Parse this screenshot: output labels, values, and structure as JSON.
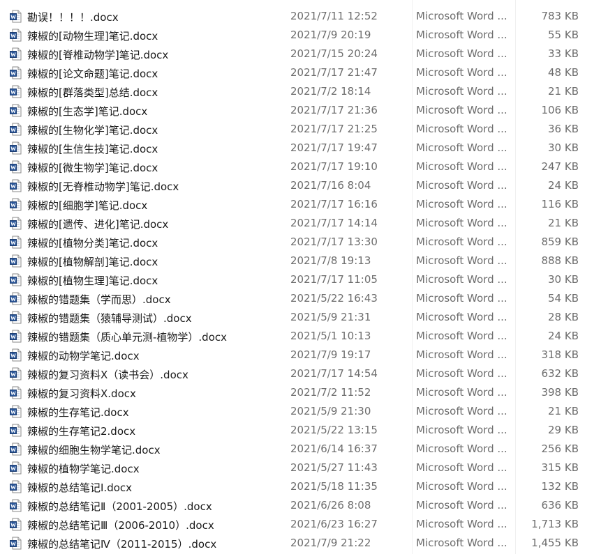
{
  "theme": {
    "word_blue": "#2b579a",
    "text": "#1a1a1a",
    "secondary_text": "#6d6d6d"
  },
  "files": [
    {
      "name": "勘误！！！！.docx",
      "modified": "2021/7/11 12:52",
      "type": "Microsoft Word ...",
      "size": "783 KB",
      "icon": "word-doc-icon"
    },
    {
      "name": "辣椒的[动物生理]笔记.docx",
      "modified": "2021/7/9 20:19",
      "type": "Microsoft Word ...",
      "size": "55 KB",
      "icon": "word-doc-icon"
    },
    {
      "name": "辣椒的[脊椎动物学]笔记.docx",
      "modified": "2021/7/15 20:24",
      "type": "Microsoft Word ...",
      "size": "33 KB",
      "icon": "word-doc-icon"
    },
    {
      "name": "辣椒的[论文命题]笔记.docx",
      "modified": "2021/7/17 21:47",
      "type": "Microsoft Word ...",
      "size": "48 KB",
      "icon": "word-doc-icon"
    },
    {
      "name": "辣椒的[群落类型]总结.docx",
      "modified": "2021/7/2 18:14",
      "type": "Microsoft Word ...",
      "size": "21 KB",
      "icon": "word-doc-icon"
    },
    {
      "name": "辣椒的[生态学]笔记.docx",
      "modified": "2021/7/17 21:36",
      "type": "Microsoft Word ...",
      "size": "106 KB",
      "icon": "word-doc-icon"
    },
    {
      "name": "辣椒的[生物化学]笔记.docx",
      "modified": "2021/7/17 21:25",
      "type": "Microsoft Word ...",
      "size": "36 KB",
      "icon": "word-doc-icon"
    },
    {
      "name": "辣椒的[生信生技]笔记.docx",
      "modified": "2021/7/17 19:47",
      "type": "Microsoft Word ...",
      "size": "30 KB",
      "icon": "word-doc-icon"
    },
    {
      "name": "辣椒的[微生物学]笔记.docx",
      "modified": "2021/7/17 19:10",
      "type": "Microsoft Word ...",
      "size": "247 KB",
      "icon": "word-doc-icon"
    },
    {
      "name": "辣椒的[无脊椎动物学]笔记.docx",
      "modified": "2021/7/16 8:04",
      "type": "Microsoft Word ...",
      "size": "24 KB",
      "icon": "word-doc-icon"
    },
    {
      "name": "辣椒的[细胞学]笔记.docx",
      "modified": "2021/7/17 16:16",
      "type": "Microsoft Word ...",
      "size": "116 KB",
      "icon": "word-doc-icon"
    },
    {
      "name": "辣椒的[遗传、进化]笔记.docx",
      "modified": "2021/7/17 14:14",
      "type": "Microsoft Word ...",
      "size": "21 KB",
      "icon": "word-doc-icon"
    },
    {
      "name": "辣椒的[植物分类]笔记.docx",
      "modified": "2021/7/17 13:30",
      "type": "Microsoft Word ...",
      "size": "859 KB",
      "icon": "word-doc-icon"
    },
    {
      "name": "辣椒的[植物解剖]笔记.docx",
      "modified": "2021/7/8 19:13",
      "type": "Microsoft Word ...",
      "size": "888 KB",
      "icon": "word-doc-icon"
    },
    {
      "name": "辣椒的[植物生理]笔记.docx",
      "modified": "2021/7/17 11:05",
      "type": "Microsoft Word ...",
      "size": "30 KB",
      "icon": "word-doc-icon"
    },
    {
      "name": "辣椒的错题集（学而思）.docx",
      "modified": "2021/5/22 16:43",
      "type": "Microsoft Word ...",
      "size": "54 KB",
      "icon": "word-doc-icon"
    },
    {
      "name": "辣椒的错题集（猿辅导测试）.docx",
      "modified": "2021/5/9 21:31",
      "type": "Microsoft Word ...",
      "size": "28 KB",
      "icon": "word-doc-icon"
    },
    {
      "name": "辣椒的错题集（质心单元测-植物学）.docx",
      "modified": "2021/5/1 10:13",
      "type": "Microsoft Word ...",
      "size": "24 KB",
      "icon": "word-doc-icon"
    },
    {
      "name": "辣椒的动物学笔记.docx",
      "modified": "2021/7/9 19:17",
      "type": "Microsoft Word ...",
      "size": "318 KB",
      "icon": "word-doc-icon"
    },
    {
      "name": "辣椒的复习资料X（读书会）.docx",
      "modified": "2021/7/17 14:54",
      "type": "Microsoft Word ...",
      "size": "632 KB",
      "icon": "word-doc-icon"
    },
    {
      "name": "辣椒的复习资料X.docx",
      "modified": "2021/7/2 11:52",
      "type": "Microsoft Word ...",
      "size": "398 KB",
      "icon": "word-doc-icon"
    },
    {
      "name": "辣椒的生存笔记.docx",
      "modified": "2021/5/9 21:30",
      "type": "Microsoft Word ...",
      "size": "21 KB",
      "icon": "word-doc-icon"
    },
    {
      "name": "辣椒的生存笔记2.docx",
      "modified": "2021/5/22 13:15",
      "type": "Microsoft Word ...",
      "size": "29 KB",
      "icon": "word-doc-icon"
    },
    {
      "name": "辣椒的细胞生物学笔记.docx",
      "modified": "2021/6/14 16:37",
      "type": "Microsoft Word ...",
      "size": "256 KB",
      "icon": "word-doc-icon"
    },
    {
      "name": "辣椒的植物学笔记.docx",
      "modified": "2021/5/27 11:43",
      "type": "Microsoft Word ...",
      "size": "315 KB",
      "icon": "word-doc-icon"
    },
    {
      "name": "辣椒的总结笔记Ⅰ.docx",
      "modified": "2021/5/18 11:35",
      "type": "Microsoft Word ...",
      "size": "132 KB",
      "icon": "word-doc-icon"
    },
    {
      "name": "辣椒的总结笔记Ⅱ（2001-2005）.docx",
      "modified": "2021/6/26 8:08",
      "type": "Microsoft Word ...",
      "size": "636 KB",
      "icon": "word-doc-icon"
    },
    {
      "name": "辣椒的总结笔记Ⅲ（2006-2010）.docx",
      "modified": "2021/6/23 16:27",
      "type": "Microsoft Word ...",
      "size": "1,713 KB",
      "icon": "word-doc-icon"
    },
    {
      "name": "辣椒的总结笔记Ⅳ（2011-2015）.docx",
      "modified": "2021/7/9 21:22",
      "type": "Microsoft Word ...",
      "size": "1,455 KB",
      "icon": "word-doc-icon"
    }
  ]
}
